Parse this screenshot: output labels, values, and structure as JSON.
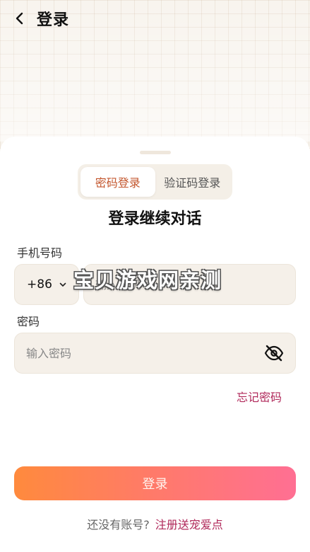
{
  "header": {
    "title": "登录"
  },
  "tabs": [
    {
      "label": "密码登录",
      "active": true
    },
    {
      "label": "验证码登录",
      "active": false
    }
  ],
  "form": {
    "heading": "登录继续对话",
    "phone_label": "手机号码",
    "country_code": "+86",
    "phone_placeholder": "输入手机号",
    "password_label": "密码",
    "password_placeholder": "输入密码",
    "forgot_password": "忘记密码"
  },
  "login_button": "登录",
  "signup": {
    "question": "还没有账号?",
    "link": "注册送宠爱点"
  },
  "watermark": "宝贝游戏网亲测",
  "colors": {
    "accent": "#c3562d",
    "link": "#b0285a",
    "gradient_start": "#ff8a3d",
    "gradient_end": "#ff6f93"
  }
}
